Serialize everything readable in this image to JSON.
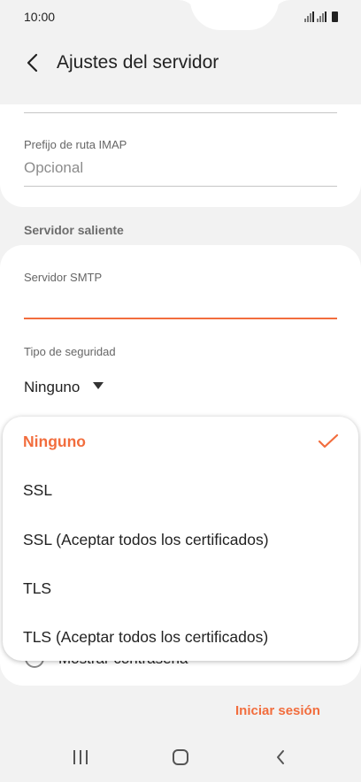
{
  "status_bar": {
    "time": "10:00"
  },
  "header": {
    "title": "Ajustes del servidor"
  },
  "incoming": {
    "imap_prefix_label": "Prefijo de ruta IMAP",
    "imap_prefix_placeholder": "Opcional"
  },
  "outgoing": {
    "section_title": "Servidor saliente",
    "smtp_label": "Servidor SMTP",
    "smtp_value": "",
    "security_label": "Tipo de seguridad",
    "security_value": "Ninguno",
    "show_password_label": "Mostrar contraseña"
  },
  "security_dropdown": {
    "options": [
      {
        "label": "Ninguno",
        "selected": true
      },
      {
        "label": "SSL",
        "selected": false
      },
      {
        "label": "SSL (Aceptar todos los certificados)",
        "selected": false
      },
      {
        "label": "TLS",
        "selected": false
      },
      {
        "label": "TLS (Aceptar todos los certificados)",
        "selected": false
      }
    ]
  },
  "actions": {
    "login_label": "Iniciar sesión"
  },
  "colors": {
    "accent": "#f26d3d",
    "background": "#f2f2f2",
    "card": "#ffffff"
  },
  "icons": [
    "back-arrow-icon",
    "signal-icon",
    "battery-icon",
    "dropdown-arrow-icon",
    "checkmark-icon",
    "recent-apps-icon",
    "home-icon",
    "nav-back-icon"
  ]
}
